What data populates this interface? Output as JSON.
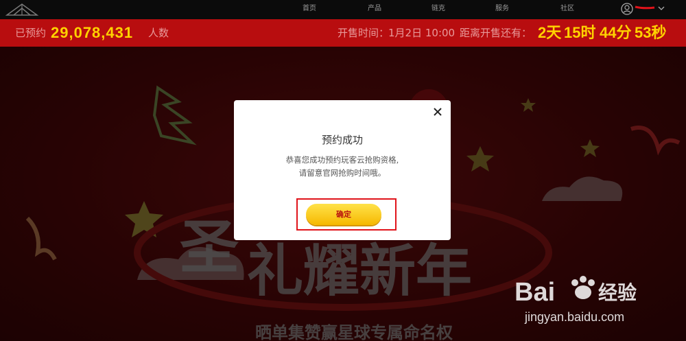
{
  "nav": {
    "items": [
      "首页",
      "产品",
      "链克",
      "服务",
      "社区"
    ]
  },
  "info": {
    "reserved_label": "已预约",
    "reserved_count": "29,078,431",
    "reserved_unit": "人数",
    "sale_time_label": "开售时间：",
    "sale_time_value": "1月2日 10:00",
    "countdown_label": "距离开售还有：",
    "countdown": {
      "days": "2天",
      "hours": "15时",
      "minutes": "44分",
      "seconds": "53秒"
    }
  },
  "banner": {
    "headline_1": "圣",
    "headline_2": "礼耀新年",
    "subline": "晒单集赞赢星球专属命名权"
  },
  "dialog": {
    "title": "预约成功",
    "message_line1": "恭喜您成功预约玩客云抢购资格,",
    "message_line2": "请留意官网抢购时间哦。",
    "confirm_label": "确定"
  },
  "watermark": {
    "brand": "Bai",
    "brand_suffix": "经验",
    "url": "jingyan.baidu.com"
  },
  "colors": {
    "nav_bg": "#0b0b0b",
    "bar_bg": "#b80d0f",
    "accent_yellow": "#ffd200",
    "annotation_red": "#e0131a"
  }
}
